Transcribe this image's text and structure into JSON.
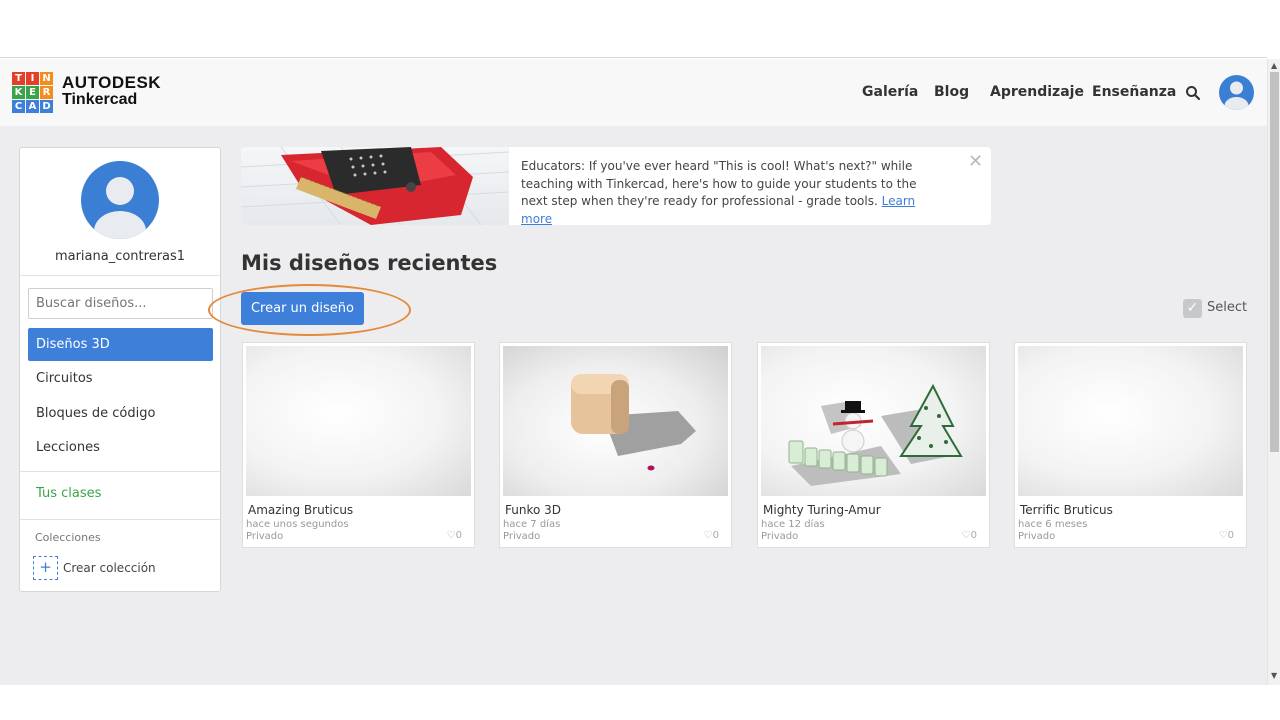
{
  "header": {
    "logo_letters": [
      "T",
      "I",
      "N",
      "K",
      "E",
      "R",
      "C",
      "A",
      "D"
    ],
    "logo_colors": [
      "#e2402b",
      "#e2402b",
      "#f08f1f",
      "#3aa548",
      "#3aa548",
      "#f08f1f",
      "#3d7fd9",
      "#3d7fd9",
      "#3d7fd9"
    ],
    "brand_line1": "AUTODESK",
    "brand_line2": "Tinkercad",
    "nav": [
      "Galería",
      "Blog",
      "Aprendizaje",
      "Enseñanza"
    ]
  },
  "sidebar": {
    "username": "mariana_contreras1",
    "search_placeholder": "Buscar diseños...",
    "menu": [
      "Diseños 3D",
      "Circuitos",
      "Bloques de código",
      "Lecciones"
    ],
    "active_index": 0,
    "classes": "Tus clases",
    "collections_label": "Colecciones",
    "create_collection": "Crear colección"
  },
  "banner": {
    "text": "Educators: If you've ever heard \"This is cool! What's next?\" while teaching with Tinkercad, here's how to guide your students to the next step when they're ready for professional - grade tools. ",
    "link": "Learn more",
    "close": "✕"
  },
  "main": {
    "title": "Mis diseños recientes",
    "create_button": "Crear un diseño",
    "select_label": "Select"
  },
  "designs": [
    {
      "title": "Amazing Bruticus",
      "time": "hace unos segundos",
      "privacy": "Privado",
      "likes": "♡0"
    },
    {
      "title": "Funko 3D",
      "time": "hace 7 días",
      "privacy": "Privado",
      "likes": "♡0"
    },
    {
      "title": "Mighty Turing-Amur",
      "time": "hace 12 días",
      "privacy": "Privado",
      "likes": "♡0"
    },
    {
      "title": "Terrific Bruticus",
      "time": "hace 6 meses",
      "privacy": "Privado",
      "likes": "♡0"
    }
  ],
  "colors": {
    "accent": "#3d7fd9",
    "green": "#3aa548",
    "highlight_ring": "#e58a3c"
  }
}
